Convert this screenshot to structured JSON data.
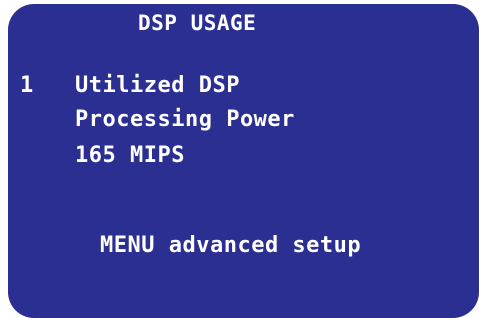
{
  "screen": {
    "title": "DSP USAGE",
    "item_number": "1",
    "lines": [
      "Utilized DSP",
      "Processing Power",
      "165 MIPS"
    ],
    "menu_hint": "MENU advanced setup",
    "background_color": "#2b2f91",
    "text_color": "#ffffff"
  }
}
